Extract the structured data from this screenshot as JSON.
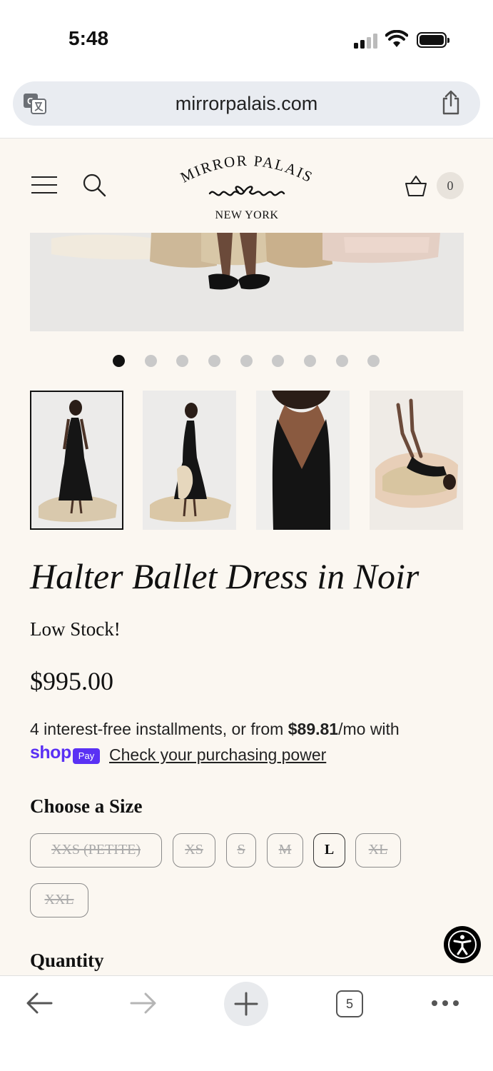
{
  "status_bar": {
    "time": "5:48"
  },
  "browser": {
    "url": "mirrorpalais.com",
    "open_tabs": "5"
  },
  "header": {
    "brand_line1": "MIRROR PALAIS",
    "brand_line2": "NEW YORK",
    "cart_count": "0"
  },
  "gallery": {
    "slide_count": 9,
    "active_slide": 1,
    "thumbnails": [
      "thumbnail-1",
      "thumbnail-2",
      "thumbnail-3",
      "thumbnail-4"
    ]
  },
  "product": {
    "title": "Halter Ballet Dress in Noir",
    "stock_status": "Low Stock!",
    "price": "$995.00",
    "installments_prefix": "4 interest-free installments, or from ",
    "installments_amount": "$89.81",
    "installments_suffix": "/mo with",
    "shop_word": "shop",
    "pay_badge": "Pay",
    "check_link": "Check your purchasing power"
  },
  "size_selector": {
    "label": "Choose a Size",
    "options": [
      {
        "label": "XXS (PETITE)",
        "available": false
      },
      {
        "label": "XS",
        "available": false
      },
      {
        "label": "S",
        "available": false
      },
      {
        "label": "M",
        "available": false
      },
      {
        "label": "L",
        "available": true
      },
      {
        "label": "XL",
        "available": false
      },
      {
        "label": "XXL",
        "available": false
      }
    ]
  },
  "quantity": {
    "label": "Quantity"
  },
  "colors": {
    "background": "#fbf7f1",
    "shop_pay_purple": "#5a31f4",
    "text": "#111111"
  }
}
